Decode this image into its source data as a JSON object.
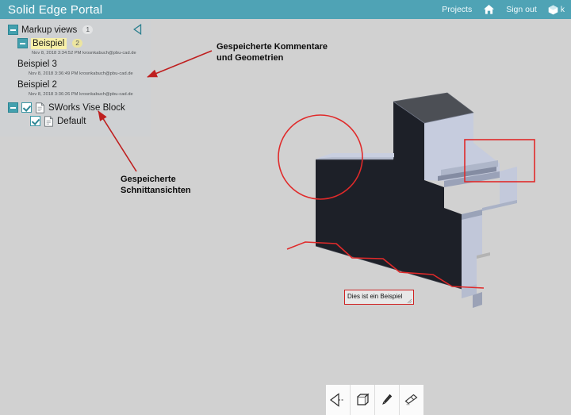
{
  "header": {
    "title": "Solid Edge Portal",
    "projects_label": "Projects",
    "home_icon": "home-icon",
    "signout_label": "Sign out",
    "cube_icon": "cube-icon",
    "user_label": "k",
    "background_color": "#4fa3b5"
  },
  "tree": {
    "collapse_icon": "collapse-left-arrow-icon",
    "markup_root": {
      "label": "Markup views",
      "badge": "1"
    },
    "items": [
      {
        "label": "Beispiel",
        "badge": "2",
        "meta": "Nov 8, 2018 3:34:52 PM krosnkabuch@pbu-cad.de",
        "highlighted": true
      },
      {
        "label": "Beispiel 3",
        "badge": "",
        "meta": "Nov 8, 2018 3:36:49 PM krosnkabuch@pbu-cad.de",
        "highlighted": false
      },
      {
        "label": "Beispiel 2",
        "badge": "",
        "meta": "Nov 8, 2018 3:36:26 PM krosnkabuch@pbu-cad.de",
        "highlighted": false
      }
    ],
    "model_node": {
      "label": "SWorks Vise Block",
      "icon": "document-icon"
    },
    "model_child": {
      "label": "Default",
      "icon": "document-icon"
    }
  },
  "annotations": {
    "comments": "Gespeicherte Kommentare\nund Geometrien",
    "sections": "Gespeicherte\nSchnittansichten",
    "arrow_color": "#c02020"
  },
  "markup": {
    "textbox_value": "Dies ist ein Beispiel",
    "stroke_color": "#dd2222"
  },
  "toolbar": {
    "buttons": [
      {
        "name": "section-view-tool",
        "icon": "section-plane-icon"
      },
      {
        "name": "3d-view-tool",
        "icon": "cube-icon"
      },
      {
        "name": "pencil-tool",
        "icon": "pencil-icon"
      },
      {
        "name": "eraser-tool",
        "icon": "eraser-icon"
      }
    ]
  },
  "viewport": {
    "background_color": "#d1d1d1",
    "model_dark_color": "#1d2028",
    "model_light_color": "#c3c9dd"
  }
}
